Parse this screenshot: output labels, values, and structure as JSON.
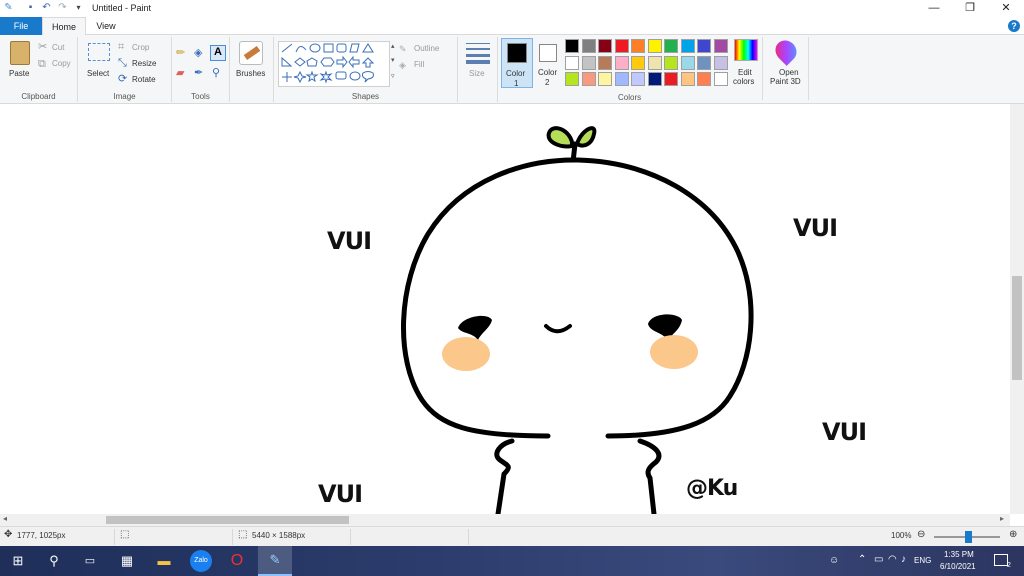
{
  "window": {
    "title": "Untitled - Paint"
  },
  "tabs": {
    "file": "File",
    "home": "Home",
    "view": "View"
  },
  "ribbon": {
    "clipboard": {
      "paste": "Paste",
      "cut": "Cut",
      "copy": "Copy",
      "group": "Clipboard"
    },
    "image": {
      "select": "Select",
      "crop": "Crop",
      "resize": "Resize",
      "rotate": "Rotate",
      "group": "Image"
    },
    "tools": {
      "group": "Tools"
    },
    "brushes": {
      "label": "Brushes"
    },
    "shapes": {
      "outline": "Outline",
      "fill": "Fill",
      "group": "Shapes"
    },
    "size": {
      "label": "Size"
    },
    "color1": {
      "label": "Color",
      "num": "1"
    },
    "color2": {
      "label": "Color",
      "num": "2"
    },
    "colors_group": "Colors",
    "edit_colors": {
      "line1": "Edit",
      "line2": "colors"
    },
    "paint3d": {
      "line1": "Open",
      "line2": "Paint 3D"
    },
    "palette": [
      [
        "#000000",
        "#7f7f7f",
        "#880015",
        "#ed1c24",
        "#ff7f27",
        "#fff200",
        "#22b14c",
        "#00a2e8",
        "#3f48cc",
        "#a349a4"
      ],
      [
        "#ffffff",
        "#c3c3c3",
        "#b97a57",
        "#ffaec9",
        "#ffc90e",
        "#efe4b0",
        "#b5e61d",
        "#99d9ea",
        "#7092be",
        "#c8bfe7"
      ],
      [
        "#b5e61d",
        "#f79a7f",
        "#fff5a0",
        "#9fb8ff",
        "#c0c8ff",
        "#001a7a",
        "#ed1c24",
        "#ffc480",
        "#ff7f50",
        "#ffffff"
      ]
    ]
  },
  "canvas": {
    "texts": {
      "vui1": "VUI",
      "vui2": "VUI",
      "vui3": "VUI",
      "vui4": "VUI",
      "signature": "@Ku"
    }
  },
  "status": {
    "cursor": "1777, 1025px",
    "size": "5440 × 1588px",
    "zoom": "100%"
  },
  "taskbar": {
    "lang": "ENG",
    "time": "1:35 PM",
    "date": "6/10/2021",
    "notif_count": "2"
  }
}
